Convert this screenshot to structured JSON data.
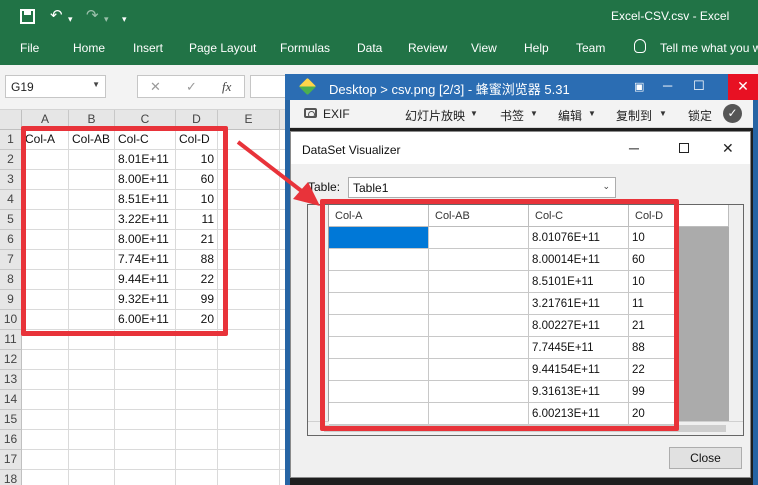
{
  "excel": {
    "title": "Excel-CSV.csv  -  Excel",
    "quick_access": {
      "undo": "↶",
      "redo": "↷",
      "dropdown": "▾"
    },
    "ribbon_tabs": [
      "File",
      "Home",
      "Insert",
      "Page Layout",
      "Formulas",
      "Data",
      "Review",
      "View",
      "Help",
      "Team"
    ],
    "tell_me": "Tell me what you w",
    "name_box": "G19",
    "formula_buttons": {
      "cancel": "✕",
      "enter": "✓",
      "fx": "fx"
    },
    "columns": [
      "A",
      "B",
      "C",
      "D",
      "E"
    ],
    "rows": [
      "1",
      "2",
      "3",
      "4",
      "5",
      "6",
      "7",
      "8",
      "9",
      "10",
      "11",
      "12",
      "13",
      "14",
      "15",
      "16",
      "17",
      "18"
    ],
    "cells": [
      [
        "Col-A",
        "Col-AB",
        "Col-C",
        "Col-D"
      ],
      [
        "",
        "",
        "8.01E+11",
        "10"
      ],
      [
        "",
        "",
        "8.00E+11",
        "60"
      ],
      [
        "",
        "",
        "8.51E+11",
        "10"
      ],
      [
        "",
        "",
        "3.22E+11",
        "11"
      ],
      [
        "",
        "",
        "8.00E+11",
        "21"
      ],
      [
        "",
        "",
        "7.74E+11",
        "88"
      ],
      [
        "",
        "",
        "9.44E+11",
        "22"
      ],
      [
        "",
        "",
        "9.32E+11",
        "99"
      ],
      [
        "",
        "",
        "6.00E+11",
        "20"
      ]
    ]
  },
  "viewer": {
    "title": "Desktop > csv.png [2/3] - 蜂蜜浏览器 5.31",
    "toolbar": {
      "exif": "EXIF",
      "slideshow": "幻灯片放映",
      "bookmarks": "书签",
      "edit": "编辑",
      "copy_to": "复制到",
      "lock": "锁定"
    }
  },
  "dialog": {
    "title": "DataSet Visualizer",
    "table_label": "Table:",
    "table_selected": "Table1",
    "columns": [
      "Col-A",
      "Col-AB",
      "Col-C",
      "Col-D"
    ],
    "rows": [
      [
        "",
        "",
        "8.01076E+11",
        "10"
      ],
      [
        "",
        "",
        "8.00014E+11",
        "60"
      ],
      [
        "",
        "",
        "8.5101E+11",
        "10"
      ],
      [
        "",
        "",
        "3.21761E+11",
        "11"
      ],
      [
        "",
        "",
        "8.00227E+11",
        "21"
      ],
      [
        "",
        "",
        "7.7445E+11",
        "88"
      ],
      [
        "",
        "",
        "9.44154E+11",
        "22"
      ],
      [
        "",
        "",
        "9.31613E+11",
        "99"
      ],
      [
        "",
        "",
        "6.00213E+11",
        "20"
      ]
    ],
    "close_label": "Close"
  },
  "annotation_color": "#e8333a"
}
